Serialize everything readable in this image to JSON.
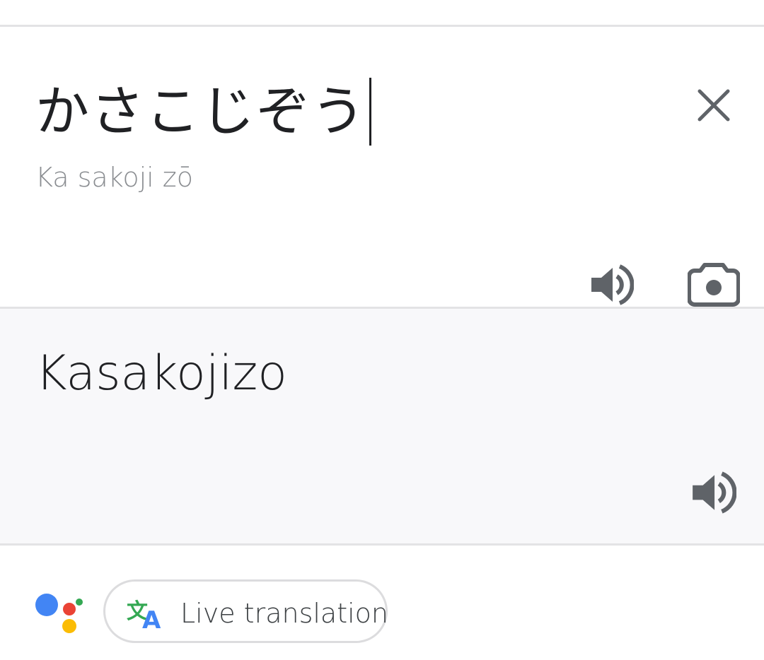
{
  "source": {
    "text": "かさこじぞう",
    "transliteration": "Ka sakoji zō",
    "clear_icon": "close-icon",
    "speaker_icon": "speaker-icon",
    "camera_icon": "camera-icon"
  },
  "result": {
    "text": "Kasakojizo",
    "speaker_icon": "speaker-icon"
  },
  "footer": {
    "assistant_icon": "google-assistant-icon",
    "live_translation_label": "Live translation",
    "live_translation_icon": "translate-icon"
  },
  "colors": {
    "icon_gray": "#5f6368",
    "assistant_blue": "#4285f4",
    "assistant_red": "#ea4335",
    "assistant_yellow": "#fbbc04",
    "assistant_green": "#34a853"
  }
}
